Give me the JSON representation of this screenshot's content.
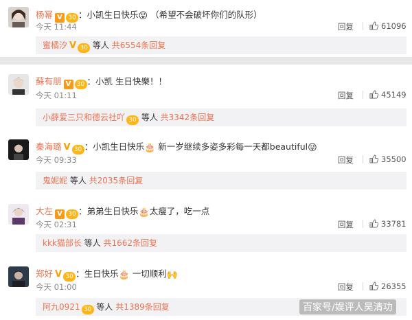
{
  "comments": [
    {
      "username": "杨幂",
      "verified": "V",
      "level": "30",
      "text_prefix": "：小凯生日快乐",
      "emoji": "😝",
      "text_suffix": " （希望不会破坏你们的队形）",
      "time": "今天 11:44",
      "reply_label": "回复",
      "likes": "61096",
      "sub_reply": {
        "name": "蜜橘汐",
        "badge": "V",
        "level": "30",
        "suffix": " 等人 ",
        "count": "共6554条回复"
      }
    },
    {
      "username": "蘇有朋",
      "verified": "V",
      "level": "30",
      "text_prefix": "：小凯 生日快樂！！",
      "emoji": "",
      "text_suffix": "",
      "time": "今天 01:11",
      "reply_label": "回复",
      "likes": "45149",
      "sub_reply": {
        "name": "小薛爱三只和德云社吖",
        "badge": "",
        "level": "30",
        "suffix": " 等人 ",
        "count": "共3342条回复"
      }
    },
    {
      "username": "秦海璐",
      "verified": "V",
      "level": "30",
      "text_prefix": "：小凯生日快乐",
      "emoji": "🎂",
      "text_suffix": " 新一岁继续多姿多彩每一天都beautiful",
      "emoji2": "😜",
      "time": "今天 09:33",
      "reply_label": "回复",
      "likes": "35500",
      "sub_reply": {
        "name": "鬼妮妮",
        "badge": "",
        "level": "",
        "suffix": " 等人 ",
        "count": "共2035条回复"
      }
    },
    {
      "username": "大左",
      "verified": "V",
      "level": "30",
      "text_prefix": "：弟弟生日快乐",
      "emoji": "🎂",
      "text_suffix": "太瘦了，吃一点",
      "time": "今天 02:31",
      "reply_label": "回复",
      "likes": "33781",
      "sub_reply": {
        "name": "kkk猫部长",
        "badge": "",
        "level": "",
        "suffix": " 等人 ",
        "count": "共1662条回复"
      }
    },
    {
      "username": "郑好",
      "verified": "V",
      "level": "30",
      "text_prefix": "：生日快乐",
      "emoji": "🎂",
      "text_suffix": " 一切顺利",
      "emoji2": "🙌",
      "time": "今天 01:00",
      "reply_label": "回复",
      "likes": "26355",
      "sub_reply": {
        "name": "阿九0921",
        "badge": "",
        "level": "30",
        "suffix": " 等人 ",
        "count": "共1389条回复"
      }
    }
  ],
  "watermark": "百家号/娱评人吴清功",
  "colors": {
    "name": "#eb7350",
    "meta": "#888888",
    "sub_bg": "#f2f2f5"
  }
}
